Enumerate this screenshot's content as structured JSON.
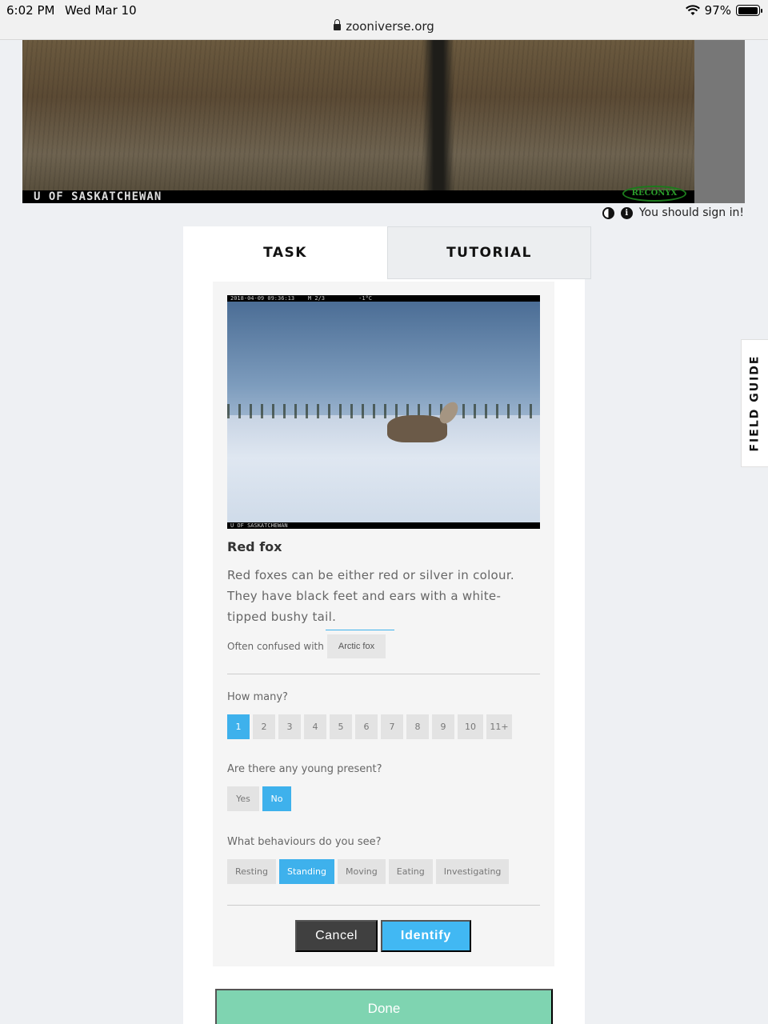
{
  "status_bar": {
    "time": "6:02 PM",
    "date": "Wed Mar 10",
    "battery": "97%",
    "battery_level": 0.97,
    "url": "zooniverse.org"
  },
  "subject_image": {
    "caption": "U OF SASKATCHEWAN",
    "logo": "RECONYX"
  },
  "signin": {
    "message": "You should sign in!"
  },
  "tabs": [
    {
      "label": "TASK"
    },
    {
      "label": "TUTORIAL"
    }
  ],
  "species": {
    "photo_header": "2018-04-09 09:36:13    M 2/3          -1°C",
    "photo_caption": "U OF SASKATCHEWAN",
    "name": "Red fox",
    "description": "Red foxes can be either red or silver in colour. They have black feet and ears with a white-tipped bushy tail.",
    "confused_label": "Often confused with",
    "confused_with": "Arctic fox"
  },
  "questions": {
    "how_many": {
      "label": "How many?",
      "options": [
        "1",
        "2",
        "3",
        "4",
        "5",
        "6",
        "7",
        "8",
        "9",
        "10",
        "11+"
      ],
      "selected": "1"
    },
    "young": {
      "label": "Are there any young present?",
      "options": [
        "Yes",
        "No"
      ],
      "selected": "No"
    },
    "behaviours": {
      "label": "What behaviours do you see?",
      "options": [
        "Resting",
        "Standing",
        "Moving",
        "Eating",
        "Investigating"
      ],
      "selected": "Standing"
    }
  },
  "actions": {
    "cancel": "Cancel",
    "identify": "Identify",
    "done": "Done"
  },
  "field_guide": {
    "label": "FIELD GUIDE"
  },
  "colors": {
    "accent": "#3eb1ec",
    "done": "#7fd4b1",
    "cancel": "#404040"
  }
}
